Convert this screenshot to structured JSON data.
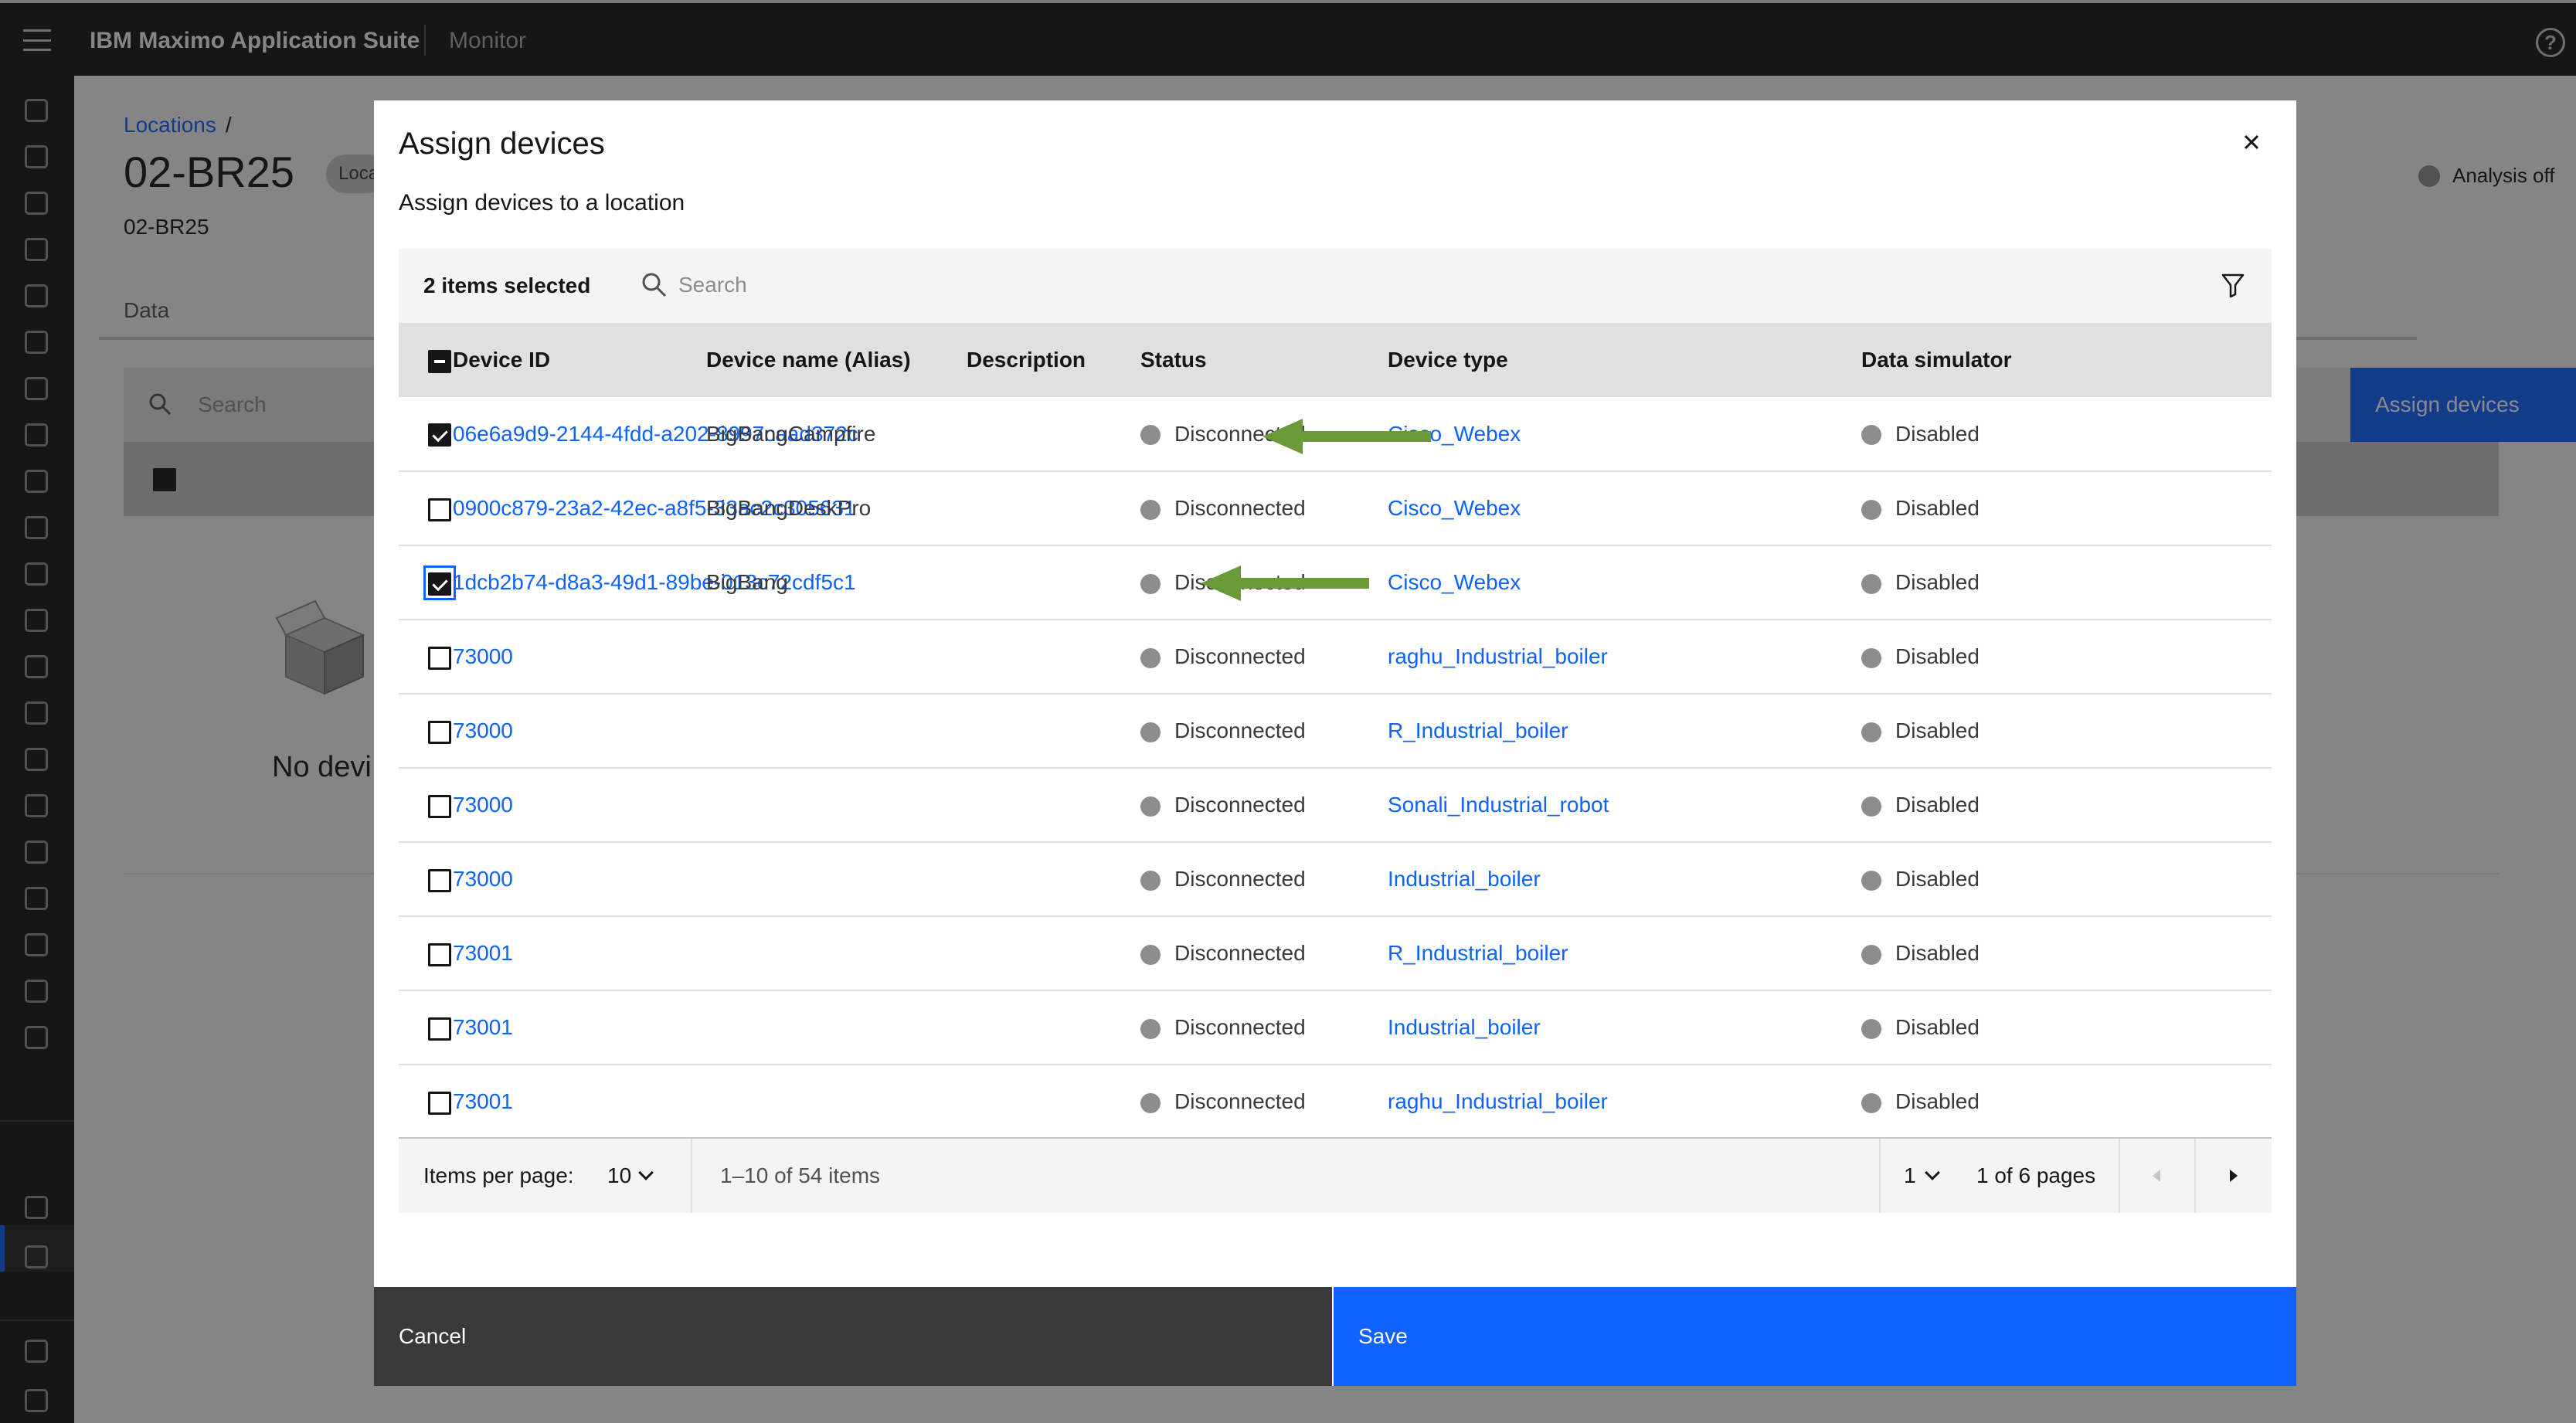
{
  "header": {
    "menu_icon": "hamburger-menu-icon",
    "brand_bold": "IBM Maximo Application Suite",
    "app_name": "Monitor",
    "help_icon": "help-icon"
  },
  "background_page": {
    "breadcrumb": "Locations",
    "breadcrumb_sep": "/",
    "title": "02-BR25",
    "tag": "Loca",
    "subtitle": "02-BR25",
    "tab": "Data",
    "search_placeholder": "Search",
    "assign_button": "Assign devices",
    "empty_text": "No devi",
    "analysis_label": "Analysis off"
  },
  "modal": {
    "title": "Assign devices",
    "subtitle": "Assign devices to a location",
    "toolbar": {
      "selected_count": "2 items selected",
      "search_placeholder": "Search"
    },
    "columns": [
      "Device ID",
      "Device name (Alias)",
      "Description",
      "Status",
      "Device type",
      "Data simulator"
    ],
    "rows": [
      {
        "checked": true,
        "device_id": "06e6a9d9-2144-4fdd-a202-8997caad372c",
        "alias": "BigBangCampfire",
        "description": "",
        "status": "Disconnected",
        "device_type": "Cisco_Webex",
        "simulator": "Disabled"
      },
      {
        "checked": false,
        "device_id": "0900c879-23a2-42ec-a8f5-33ac2c305631",
        "alias": "BigBangDeskPro",
        "description": "",
        "status": "Disconnected",
        "device_type": "Cisco_Webex",
        "simulator": "Disabled"
      },
      {
        "checked": true,
        "device_id": "1dcb2b74-d8a3-49d1-89be-013c72cdf5c1",
        "alias": "BigBang",
        "description": "",
        "status": "Disconnected",
        "device_type": "Cisco_Webex",
        "simulator": "Disabled"
      },
      {
        "checked": false,
        "device_id": "73000",
        "alias": "",
        "description": "",
        "status": "Disconnected",
        "device_type": "raghu_Industrial_boiler",
        "simulator": "Disabled"
      },
      {
        "checked": false,
        "device_id": "73000",
        "alias": "",
        "description": "",
        "status": "Disconnected",
        "device_type": "R_Industrial_boiler",
        "simulator": "Disabled"
      },
      {
        "checked": false,
        "device_id": "73000",
        "alias": "",
        "description": "",
        "status": "Disconnected",
        "device_type": "Sonali_Industrial_robot",
        "simulator": "Disabled"
      },
      {
        "checked": false,
        "device_id": "73000",
        "alias": "",
        "description": "",
        "status": "Disconnected",
        "device_type": "Industrial_boiler",
        "simulator": "Disabled"
      },
      {
        "checked": false,
        "device_id": "73001",
        "alias": "",
        "description": "",
        "status": "Disconnected",
        "device_type": "R_Industrial_boiler",
        "simulator": "Disabled"
      },
      {
        "checked": false,
        "device_id": "73001",
        "alias": "",
        "description": "",
        "status": "Disconnected",
        "device_type": "Industrial_boiler",
        "simulator": "Disabled"
      },
      {
        "checked": false,
        "device_id": "73001",
        "alias": "",
        "description": "",
        "status": "Disconnected",
        "device_type": "raghu_Industrial_boiler",
        "simulator": "Disabled"
      }
    ],
    "pagination": {
      "items_per_page_label": "Items per page:",
      "items_per_page": "10",
      "range": "1–10 of 54 items",
      "page": "1",
      "page_total": "1 of 6 pages"
    },
    "cancel_label": "Cancel",
    "save_label": "Save"
  },
  "colors": {
    "accent": "#0f62fe",
    "annotation_arrow": "#6a9a3a",
    "status_dot": "#8d8d8d"
  }
}
